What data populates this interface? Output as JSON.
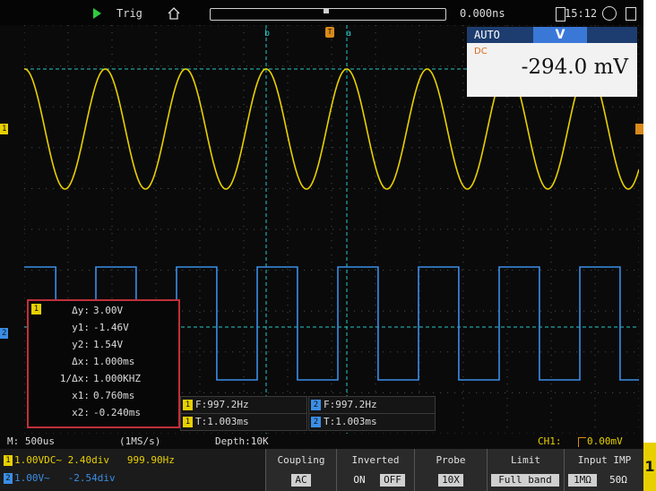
{
  "topbar": {
    "trigger_label": "Trig",
    "timebase_offset": "0.000ns",
    "clock": "15:12"
  },
  "cursors": {
    "b": "b",
    "a": "a"
  },
  "channel_markers": {
    "ch1": "1",
    "ch2": "2"
  },
  "trigger_marker": "T",
  "voltmeter": {
    "mode": "AUTO",
    "unit": "V",
    "coupling": "DC",
    "value": "-294.0 mV"
  },
  "cursor_panel": {
    "channel": "1",
    "rows": [
      {
        "label": "Δy:",
        "value": "3.00V"
      },
      {
        "label": "y1:",
        "value": "-1.46V"
      },
      {
        "label": "y2:",
        "value": "1.54V"
      },
      {
        "label": "Δx:",
        "value": "1.000ms"
      },
      {
        "label": "1/Δx:",
        "value": "1.000KHZ"
      },
      {
        "label": "x1:",
        "value": "0.760ms"
      },
      {
        "label": "x2:",
        "value": "-0.240ms"
      }
    ]
  },
  "measurements": {
    "ch1_freq": "F:997.2Hz",
    "ch1_period": "T:1.003ms",
    "ch2_freq": "F:997.2Hz",
    "ch2_period": "T:1.003ms"
  },
  "status": {
    "timebase": "M: 500us",
    "sample_rate": "(1MS/s)",
    "depth": "Depth:10K",
    "trigger_channel": "CH1:",
    "trigger_level": "0.00mV"
  },
  "channels": [
    {
      "id": "1",
      "scale": "1.00VDC~",
      "position": "2.40div",
      "freq": "999.90Hz",
      "color": "#e8d000"
    },
    {
      "id": "2",
      "scale": "1.00V~",
      "position": "-2.54div",
      "color": "#3a8ee6"
    }
  ],
  "menu": {
    "coupling": {
      "title": "Coupling",
      "value": "AC"
    },
    "inverted": {
      "title": "Inverted",
      "on": "ON",
      "off": "OFF"
    },
    "probe": {
      "title": "Probe",
      "value": "10X"
    },
    "limit": {
      "title": "Limit",
      "value": "Full band"
    },
    "input_imp": {
      "title": "Input IMP",
      "opt1": "1MΩ",
      "opt2": "50Ω"
    }
  },
  "active_channel_tab": "1",
  "colors": {
    "ch1": "#e8d000",
    "ch2": "#3a8ee6",
    "cursor": "#29c7c7",
    "trigger": "#d98a1a",
    "highlight": "#c0303a"
  }
}
